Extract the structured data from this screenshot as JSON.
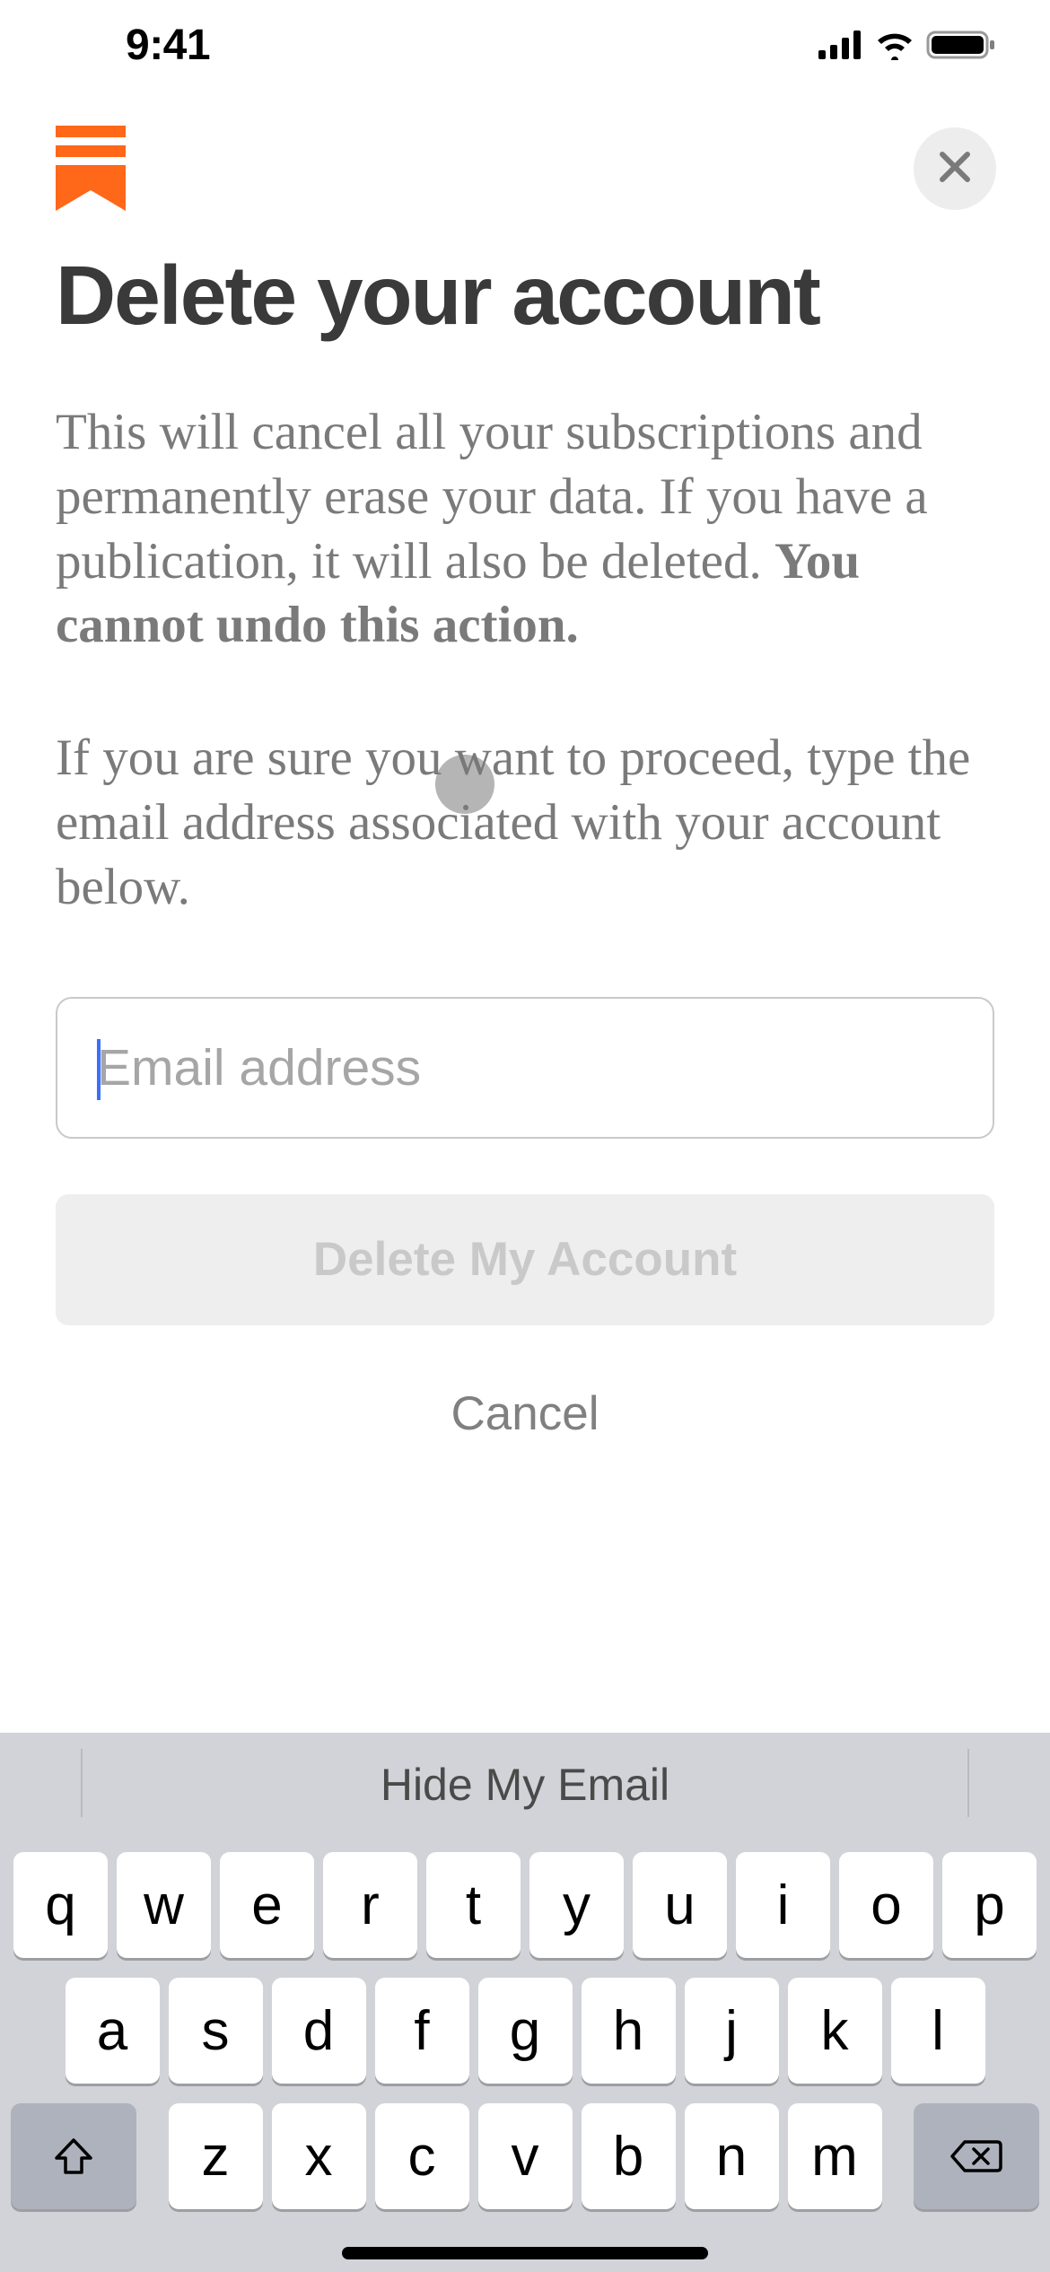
{
  "status": {
    "time": "9:41"
  },
  "header": {
    "title": "Delete your account"
  },
  "body": {
    "para1_part1": "This will cancel all your subscriptions and permanently erase your data. If you have a publication, it will also be deleted. ",
    "para1_bold": "You cannot undo this action.",
    "para2": "If you are sure you want to proceed, type the email address associated with your account below."
  },
  "form": {
    "email_placeholder": "Email address",
    "email_value": "",
    "delete_label": "Delete My Account",
    "cancel_label": "Cancel"
  },
  "keyboard": {
    "suggestion": "Hide My Email",
    "row1": [
      "q",
      "w",
      "e",
      "r",
      "t",
      "y",
      "u",
      "i",
      "o",
      "p"
    ],
    "row2": [
      "a",
      "s",
      "d",
      "f",
      "g",
      "h",
      "j",
      "k",
      "l"
    ],
    "row3": [
      "z",
      "x",
      "c",
      "v",
      "b",
      "n",
      "m"
    ]
  }
}
